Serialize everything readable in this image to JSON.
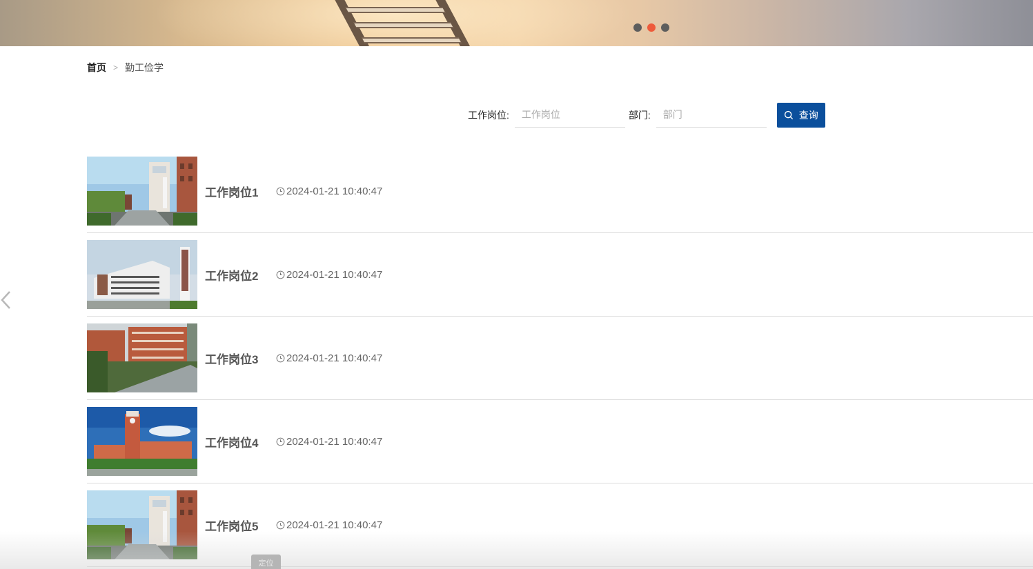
{
  "banner": {
    "carousel_dots": 3,
    "active_dot_index": 1,
    "accent_color": "#ee5a3a"
  },
  "breadcrumb": {
    "home": "首页",
    "separator": ">",
    "current": "勤工俭学"
  },
  "search": {
    "position_label": "工作岗位:",
    "position_placeholder": "工作岗位",
    "position_value": "",
    "department_label": "部门:",
    "department_placeholder": "部门",
    "department_value": "",
    "query_button": "查询",
    "button_color": "#0b4f9c"
  },
  "list": {
    "items": [
      {
        "title": "工作岗位1",
        "time": "2024-01-21 10:40:47",
        "image": "campus-gate"
      },
      {
        "title": "工作岗位2",
        "time": "2024-01-21 10:40:47",
        "image": "white-building"
      },
      {
        "title": "工作岗位3",
        "time": "2024-01-21 10:40:47",
        "image": "red-brick-buildings"
      },
      {
        "title": "工作岗位4",
        "time": "2024-01-21 10:40:47",
        "image": "clock-tower"
      },
      {
        "title": "工作岗位5",
        "time": "2024-01-21 10:40:47",
        "image": "campus-gate"
      }
    ]
  },
  "floating": {
    "locate_button": "定位"
  },
  "icons": {
    "prev": "chevron-left-icon",
    "search": "search-icon",
    "clock": "clock-icon"
  }
}
